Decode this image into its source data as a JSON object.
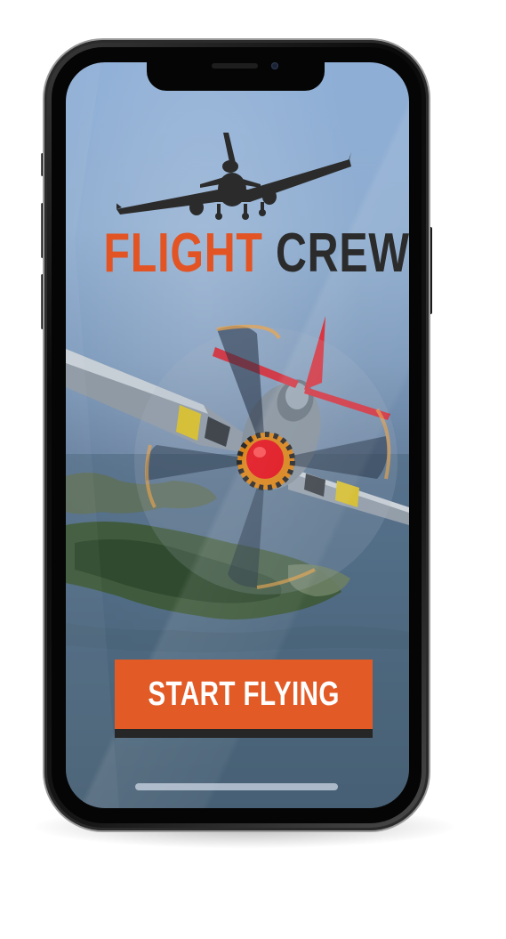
{
  "app": {
    "title_part1": "FLIGHT",
    "title_part2": "CREW",
    "brand_color": "#e25424",
    "title_dark_color": "#2b2b2b"
  },
  "hero": {
    "logo_icon": "airliner-silhouette-icon",
    "background_image": "p51-mustang-propeller-plane-over-coastline"
  },
  "cta": {
    "label": "START FLYING",
    "color": "#e25a26"
  }
}
